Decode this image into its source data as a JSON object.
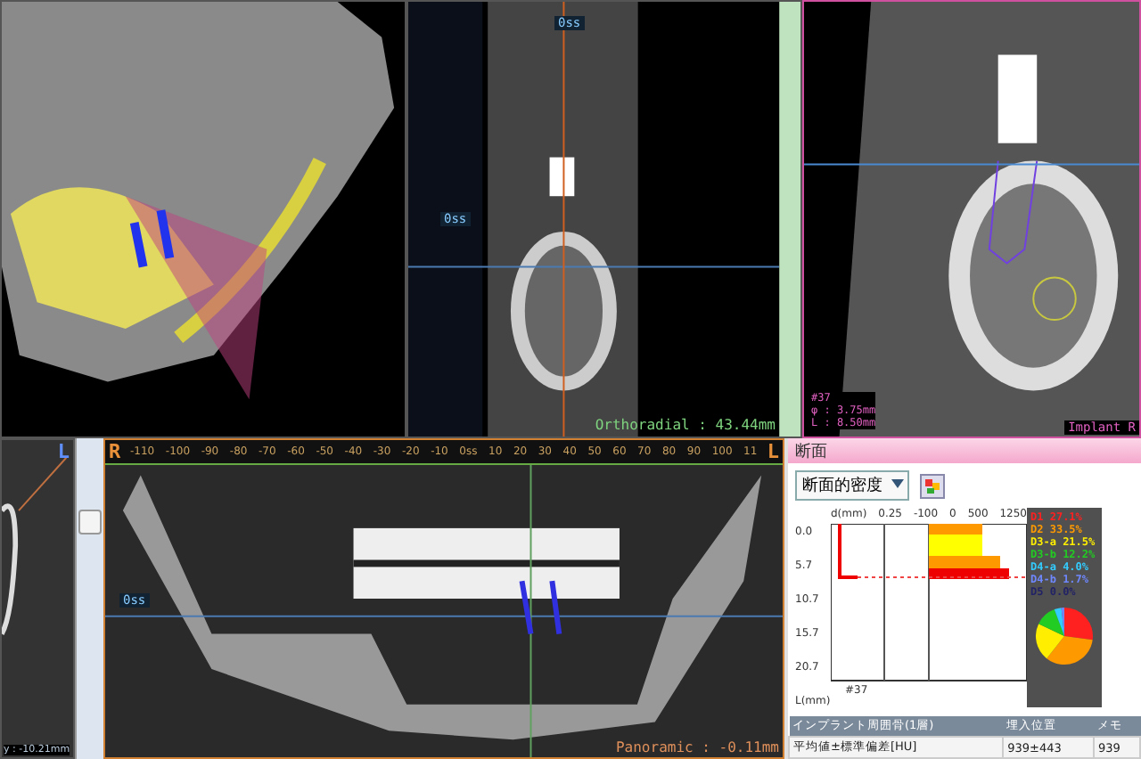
{
  "orthoradial_view": {
    "top_marker": "0ss",
    "side_marker": "0ss",
    "caption": "Orthoradial : 43.44mm"
  },
  "implant_view": {
    "info": [
      "#37",
      "φ : 3.75mm",
      "L : 8.50mm"
    ],
    "caption": "Implant R"
  },
  "axial_view": {
    "orientation": "L",
    "caption": "y : -10.21mm"
  },
  "panoramic_view": {
    "left_label": "R",
    "right_label": "L",
    "ruler": [
      "-110",
      "-100",
      "-90",
      "-80",
      "-70",
      "-60",
      "-50",
      "-40",
      "-30",
      "-20",
      "-10",
      "0ss",
      "10",
      "20",
      "30",
      "40",
      "50",
      "60",
      "70",
      "80",
      "90",
      "100",
      "11"
    ],
    "marker": "0ss",
    "caption": "Panoramic : -0.11mm"
  },
  "density_panel": {
    "title": "断面",
    "dropdown": "断面的密度",
    "histogram": {
      "top_labels": [
        "d(mm)",
        "0.25",
        "-100",
        "0",
        "500",
        "1250"
      ],
      "depth_labels": [
        "0.0",
        "5.7",
        "10.7",
        "15.7",
        "20.7"
      ],
      "axis_label": "L(mm)",
      "implant_label": "#37"
    },
    "legend": [
      {
        "label": "D1",
        "percent": "27.1%",
        "color": "#ff2020"
      },
      {
        "label": "D2",
        "percent": "33.5%",
        "color": "#ff9900"
      },
      {
        "label": "D3-a",
        "percent": "21.5%",
        "color": "#ffee00"
      },
      {
        "label": "D3-b",
        "percent": "12.2%",
        "color": "#22cc22"
      },
      {
        "label": "D4-a",
        "percent": "4.0%",
        "color": "#33ccff"
      },
      {
        "label": "D4-b",
        "percent": "1.7%",
        "color": "#6f88ff"
      },
      {
        "label": "D5",
        "percent": "0.0%",
        "color": "#222266"
      }
    ],
    "pie": {
      "chart_data": {
        "type": "pie",
        "values": [
          27.1,
          33.5,
          21.5,
          12.2,
          4.0,
          1.7,
          0.0
        ]
      }
    },
    "table": {
      "columns": [
        "インプラント周囲骨(1層)",
        "埋入位置",
        "メモ"
      ],
      "rows": [
        [
          "平均値±標準偏差[HU]",
          "939±443",
          "939"
        ]
      ]
    }
  }
}
